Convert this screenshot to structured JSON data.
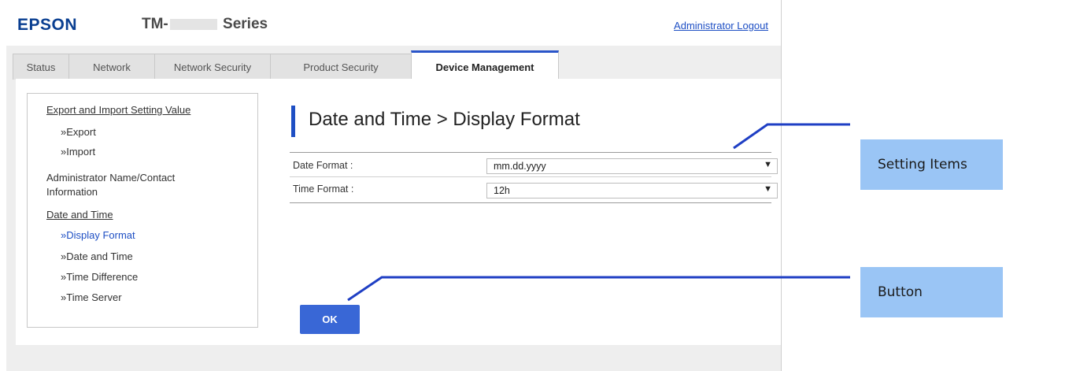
{
  "header": {
    "brand": "EPSON",
    "model_prefix": "TM-",
    "model_suffix": "Series",
    "logout_label": "Administrator Logout"
  },
  "tabs": [
    {
      "label": "Status",
      "active": false
    },
    {
      "label": "Network",
      "active": false
    },
    {
      "label": "Network Security",
      "active": false
    },
    {
      "label": "Product Security",
      "active": false
    },
    {
      "label": "Device Management",
      "active": true
    }
  ],
  "sidebar": {
    "items": [
      {
        "label": "Export and Import Setting Value"
      },
      {
        "label": "»Export"
      },
      {
        "label": "»Import"
      },
      {
        "label": "Administrator Name/Contact"
      },
      {
        "label": "Information"
      },
      {
        "label": "Date and Time"
      },
      {
        "label": "»Display Format"
      },
      {
        "label": "»Date and Time"
      },
      {
        "label": "»Time Difference"
      },
      {
        "label": "»Time Server"
      }
    ]
  },
  "main": {
    "title": "Date and Time > Display Format",
    "fields": [
      {
        "label": "Date Format :",
        "value": "mm.dd.yyyy"
      },
      {
        "label": "Time Format :",
        "value": "12h"
      }
    ],
    "ok_label": "OK"
  },
  "callouts": {
    "setting_items": "Setting Items",
    "button": "Button"
  },
  "colors": {
    "brand_blue": "#0a3f91",
    "accent": "#2a55c9",
    "button": "#3967d6",
    "callout": "#9ac5f5"
  }
}
